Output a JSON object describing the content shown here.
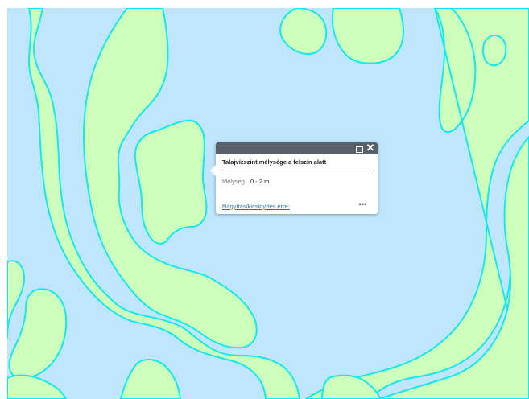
{
  "map": {
    "water_color": "#bfe6fc",
    "land_color": "#ccfebc",
    "outline_color": "#16e8ec"
  },
  "popup": {
    "title": "Talajvízszint mélysége a felszín alatt",
    "attribute_label": "Mélység",
    "attribute_value": "0 - 2 m",
    "zoom_link": "Nagyítás/kicsinyítés erre:",
    "maximize_icon": "maximize-icon",
    "close_icon": "close-icon",
    "more_icon": "ellipsis-icon",
    "close_glyph": "✕",
    "more_glyph": "•••",
    "header_color": "#58606a"
  }
}
